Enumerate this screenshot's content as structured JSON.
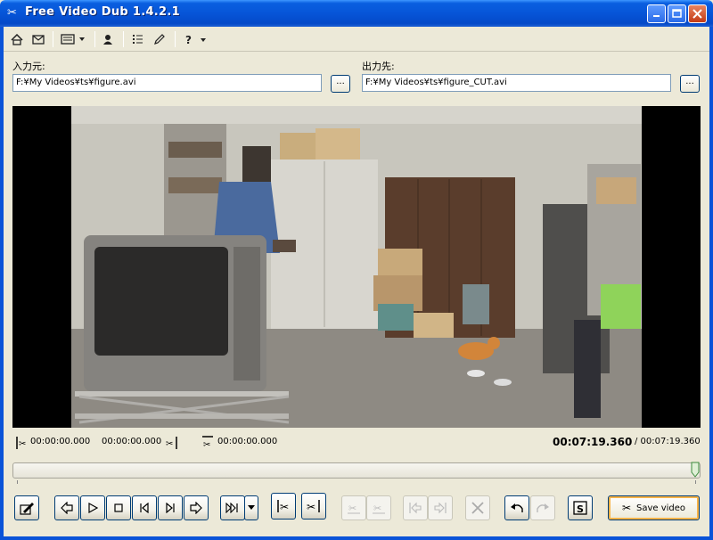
{
  "window": {
    "title": "Free Video Dub 1.4.2.1"
  },
  "toolbar": {
    "icons": [
      "home-icon",
      "mail-icon",
      "menu-list-icon",
      "user-icon",
      "checklist-icon",
      "pen-icon",
      "help-icon"
    ]
  },
  "input": {
    "label": "入力元:",
    "path": "F:¥My Videos¥ts¥figure.avi",
    "browse_label": "..."
  },
  "output": {
    "label": "出力先:",
    "path": "F:¥My Videos¥ts¥figure_CUT.avi",
    "browse_label": "..."
  },
  "timeline": {
    "cut_start": "00:00:00.000",
    "cut_end": "00:00:00.000",
    "position": "00:00:00.000",
    "current_time": "00:07:19.360",
    "total_time": "/ 00:07:19.360",
    "seek_fraction": 1.0
  },
  "controls": {
    "save_label": "Save video"
  },
  "colors": {
    "titlebar": "#0655d8",
    "window_bg": "#ece9d8",
    "accent_border": "#003c74"
  }
}
